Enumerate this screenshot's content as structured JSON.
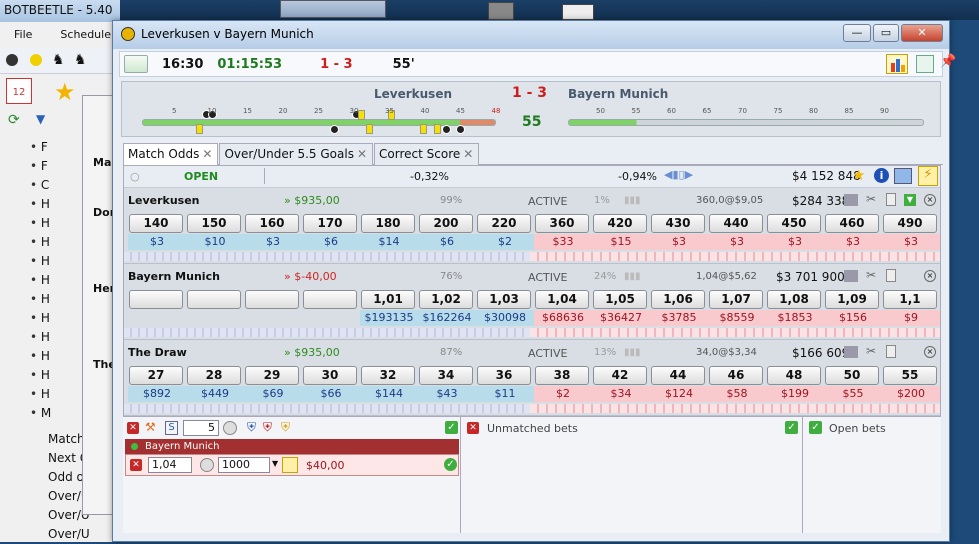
{
  "background_app": {
    "title": "BOTBEETLE - 5.40",
    "menu": [
      "File",
      "Schedulers"
    ],
    "tree_items": [
      "Match",
      "Next Go",
      "Odd or",
      "Over/U",
      "Over/U",
      "Over/U"
    ],
    "tree_short": [
      "F",
      "F",
      "C",
      "H",
      "H",
      "H",
      "H",
      "H",
      "H",
      "H",
      "H",
      "H",
      "H",
      "H",
      "M"
    ],
    "inner_labels": [
      "Dor",
      "Her",
      "The",
      "Ma"
    ]
  },
  "window": {
    "title": "Leverkusen v Bayern Munich",
    "buttons": {
      "minimize": "—",
      "maximize": "▭",
      "close": "✕"
    }
  },
  "info_bar": {
    "time": "16:30",
    "countdown": "01:15:53",
    "score": "1 - 3",
    "minute": "55'"
  },
  "score_panel": {
    "home": "Leverkusen",
    "score": "1 - 3",
    "away": "Bayern Munich",
    "minute": "55",
    "first_half_ticks": [
      "5",
      "10",
      "15",
      "20",
      "25",
      "30",
      "35",
      "40",
      "45",
      "48"
    ],
    "second_half_ticks": [
      "50",
      "55",
      "60",
      "65",
      "70",
      "75",
      "80",
      "85",
      "90"
    ]
  },
  "tabs": [
    {
      "label": "Match Odds",
      "active": true
    },
    {
      "label": "Over/Under 5.5 Goals",
      "active": false
    },
    {
      "label": "Correct Score",
      "active": false
    }
  ],
  "market_header": {
    "status": "OPEN",
    "back_overround": "-0,32%",
    "lay_overround": "-0,94%",
    "matched": "$4 152 848"
  },
  "runners": [
    {
      "name": "Leverkusen",
      "pl": "» $935,00",
      "pl_color": "#2e8b1e",
      "pct": "99%",
      "state": "ACTIVE",
      "state_pct": "1%",
      "last": "360,0@$9,05",
      "volume": "$284 338",
      "prices": [
        "140",
        "150",
        "160",
        "170",
        "180",
        "200",
        "220",
        "360",
        "420",
        "430",
        "440",
        "450",
        "460",
        "490"
      ],
      "amounts": [
        "$3",
        "$10",
        "$3",
        "$6",
        "$14",
        "$6",
        "$2",
        "$33",
        "$15",
        "$3",
        "$3",
        "$3",
        "$3",
        "$3"
      ]
    },
    {
      "name": "Bayern Munich",
      "pl": "» $-40,00",
      "pl_color": "#d0261e",
      "pct": "76%",
      "state": "ACTIVE",
      "state_pct": "24%",
      "last": "1,04@$5,62",
      "volume": "$3 701 900",
      "prices": [
        "",
        "",
        "",
        "",
        "1,01",
        "1,02",
        "1,03",
        "1,04",
        "1,05",
        "1,06",
        "1,07",
        "1,08",
        "1,09",
        "1,1"
      ],
      "amounts": [
        "",
        "",
        "",
        "",
        "$193135",
        "$162264",
        "$30098",
        "$68636",
        "$36427",
        "$3785",
        "$8559",
        "$1853",
        "$156",
        "$9"
      ]
    },
    {
      "name": "The Draw",
      "pl": "» $935,00",
      "pl_color": "#2e8b1e",
      "pct": "87%",
      "state": "ACTIVE",
      "state_pct": "13%",
      "last": "34,0@$3,34",
      "volume": "$166 609",
      "prices": [
        "27",
        "28",
        "29",
        "30",
        "32",
        "34",
        "36",
        "38",
        "42",
        "44",
        "46",
        "48",
        "50",
        "55"
      ],
      "amounts": [
        "$892",
        "$449",
        "$69",
        "$66",
        "$144",
        "$43",
        "$11",
        "$2",
        "$34",
        "$124",
        "$58",
        "$199",
        "$55",
        "$200"
      ]
    }
  ],
  "bet_panel": {
    "spinner_value": "5",
    "selection": "Bayern Munich",
    "odds": "1,04",
    "stake": "1000",
    "liability": "$40,00"
  },
  "unmatched": {
    "label": "Unmatched bets"
  },
  "open_bets": {
    "label": "Open bets"
  }
}
